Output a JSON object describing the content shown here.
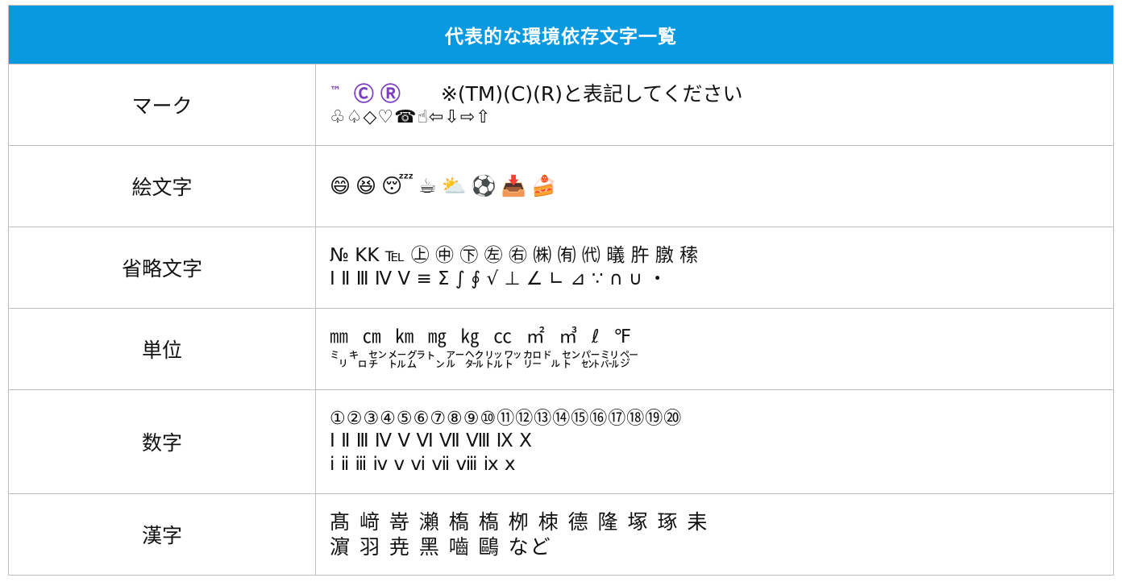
{
  "title": "代表的な環境依存文字一覧",
  "rows": [
    {
      "category": "マーク",
      "line1_tm": "™",
      "line1_c": "Ⓒ",
      "line1_r": "Ⓡ",
      "line1_note": "　　※(TM)(C)(R)と表記してください",
      "line2": "♧♤◇♡☎☝⇦⇩⇨⇧"
    },
    {
      "category": "絵文字",
      "line1": "😄😆😴☕⛅⚽📥🍰"
    },
    {
      "category": "省略文字",
      "line1": "№ KK ℡ ㊤ ㊥ ㊦ ㊧ ㊨ ㈱ ㈲ ㈹ 㬢 㬳 㬿 䅴",
      "line2": "Ⅰ Ⅱ Ⅲ Ⅳ Ⅴ ≡ Σ ∫ ∮ √ ⊥ ∠ ∟ ⊿ ∵ ∩ ∪ ・"
    },
    {
      "category": "単位",
      "line1": "㎜  ㎝  ㎞  ㎎  ㎏  ㏄  ㎡  ㎥  ℓ  ℉",
      "line2": "㍉㌔㌢㍍㌘㌧㌃㌶㍑㍗㌍㌦㌣㌫㍊㌻"
    },
    {
      "category": "数字",
      "line1": "①②③④⑤⑥⑦⑧⑨⑩⑪⑫⑬⑭⑮⑯⑰⑱⑲⑳",
      "line2": "Ⅰ Ⅱ Ⅲ Ⅳ Ⅴ Ⅵ Ⅶ Ⅷ Ⅸ Ⅹ",
      "line3": "ⅰ ⅱ ⅲ ⅳ ⅴ ⅵ ⅶ ⅷ ⅸ ⅹ"
    },
    {
      "category": "漢字",
      "line1": "髙 﨑 嵜 瀨 槗 槗 栁 栜 德 隆 塚 琢 耒",
      "line2": "濵 羽 尭 黑 嚙 鷗 など"
    }
  ]
}
